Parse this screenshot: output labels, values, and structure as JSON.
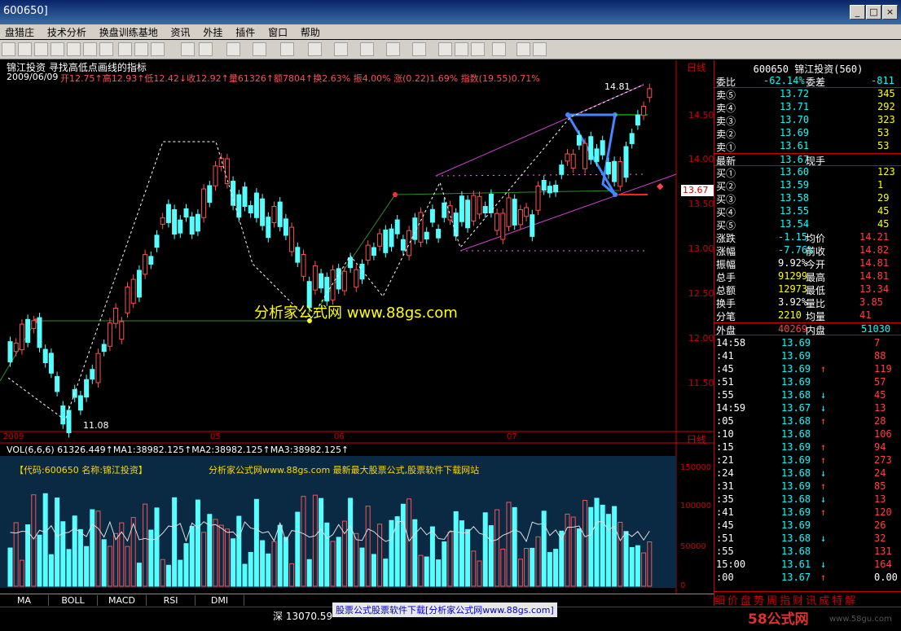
{
  "window": {
    "title": "600650]"
  },
  "menu": [
    "盘猎庄",
    "技术分析",
    "换盘训练基地",
    "资讯",
    "外挂",
    "插件",
    "窗口",
    "帮助"
  ],
  "chart_header": {
    "name_line": "锦江投资 寻找高低点画线的指标",
    "date": "2009/06/09",
    "ohlc": "开12.75↑高12.93↑低12.42↓收12.92↑量61326↑额7804↑换2.63% 振4.00% 涨(0.22)1.69% 指数(19.55)0.71%"
  },
  "price_axis": {
    "labels": [
      "14.50",
      "14.00",
      "13.50",
      "13.00",
      "12.50",
      "12.00",
      "11.50"
    ],
    "current": "13.67",
    "high_label": "14.81",
    "low_label": "11.08"
  },
  "time_axis": [
    "2009",
    "05",
    "06",
    "07"
  ],
  "period_label": "日线",
  "watermark": "分析家公式网 www.88gs.com",
  "volume_header": {
    "text": "VOL(6,6,6) 61326.449↑MA1:38982.125↑MA2:38982.125↑MA3:38982.125↑"
  },
  "volume_panel": {
    "info": "【代码:600650 名称:锦江投资】",
    "promo": "分析家公式网www.88gs.com 最新最大股票公式,股票软件下载网站",
    "axis": [
      "150000",
      "100000",
      "50000",
      "0"
    ]
  },
  "bottom_tabs": [
    "MA",
    "BOLL",
    "MACD",
    "RSI",
    "DMI"
  ],
  "status": {
    "index": "深 13070.59",
    "banner": "股票公式股票软件下载[分析家公式网www.88gs.com]",
    "logo": "58公式网",
    "url": "www.58gu.com"
  },
  "quote": {
    "title": "600650 锦江投资(560)",
    "weibi": {
      "label": "委比",
      "value": "-62.14%",
      "label2": "委差",
      "value2": "-811"
    },
    "sells": [
      {
        "label": "卖⑤",
        "price": "13.72",
        "vol": "345"
      },
      {
        "label": "卖④",
        "price": "13.71",
        "vol": "292"
      },
      {
        "label": "卖③",
        "price": "13.70",
        "vol": "323"
      },
      {
        "label": "卖②",
        "price": "13.69",
        "vol": "53"
      },
      {
        "label": "卖①",
        "price": "13.61",
        "vol": "53"
      }
    ],
    "latest": {
      "label": "最新",
      "value": "13.67",
      "label2": "现手"
    },
    "buys": [
      {
        "label": "买①",
        "price": "13.60",
        "vol": "123"
      },
      {
        "label": "买②",
        "price": "13.59",
        "vol": "1"
      },
      {
        "label": "买③",
        "price": "13.58",
        "vol": "29"
      },
      {
        "label": "买④",
        "price": "13.55",
        "vol": "45"
      },
      {
        "label": "买⑤",
        "price": "13.54",
        "vol": "45"
      }
    ],
    "stats": [
      {
        "l1": "涨跌",
        "v1": "-1.15",
        "l2": "均价",
        "v2": "14.21"
      },
      {
        "l1": "涨幅",
        "v1": "-7.76%",
        "l2": "前收",
        "v2": "14.82"
      },
      {
        "l1": "振幅",
        "v1": "9.92%",
        "l2": "今开",
        "v2": "14.81"
      },
      {
        "l1": "总手",
        "v1": "91299",
        "l2": "最高",
        "v2": "14.81"
      },
      {
        "l1": "总额",
        "v1": "12973",
        "l2": "最低",
        "v2": "13.34"
      },
      {
        "l1": "换手",
        "v1": "3.92%",
        "l2": "量比",
        "v2": "3.85"
      },
      {
        "l1": "分笔",
        "v1": "2210",
        "l2": "均量",
        "v2": "41"
      }
    ],
    "outer": {
      "l1": "外盘",
      "v1": "40269",
      "l2": "内盘",
      "v2": "51030"
    },
    "ticks": [
      {
        "t": "14:58",
        "p": "13.69",
        "a": "",
        "v": "7"
      },
      {
        "t": ":41",
        "p": "13.69",
        "a": "",
        "v": "88"
      },
      {
        "t": ":45",
        "p": "13.69",
        "a": "↑",
        "v": "119"
      },
      {
        "t": ":51",
        "p": "13.69",
        "a": "",
        "v": "57"
      },
      {
        "t": ":55",
        "p": "13.68",
        "a": "↓",
        "v": "45"
      },
      {
        "t": "14:59",
        "p": "13.67",
        "a": "↓",
        "v": "13"
      },
      {
        "t": ":05",
        "p": "13.68",
        "a": "↑",
        "v": "28"
      },
      {
        "t": ":10",
        "p": "13.68",
        "a": "",
        "v": "106"
      },
      {
        "t": ":15",
        "p": "13.69",
        "a": "↑",
        "v": "94"
      },
      {
        "t": ":21",
        "p": "13.69",
        "a": "↑",
        "v": "273"
      },
      {
        "t": ":24",
        "p": "13.68",
        "a": "↓",
        "v": "24"
      },
      {
        "t": ":31",
        "p": "13.69",
        "a": "↑",
        "v": "85"
      },
      {
        "t": ":35",
        "p": "13.68",
        "a": "↓",
        "v": "13"
      },
      {
        "t": ":41",
        "p": "13.69",
        "a": "↑",
        "v": "120"
      },
      {
        "t": ":45",
        "p": "13.69",
        "a": "",
        "v": "26"
      },
      {
        "t": ":51",
        "p": "13.68",
        "a": "↓",
        "v": "32"
      },
      {
        "t": ":55",
        "p": "13.68",
        "a": "",
        "v": "131"
      },
      {
        "t": "15:00",
        "p": "13.61",
        "a": "↓",
        "v": "164"
      },
      {
        "t": ":00",
        "p": "13.67",
        "a": "↑",
        "v": "0.00"
      }
    ],
    "tabs": [
      "细",
      "价",
      "盘",
      "势",
      "周",
      "指",
      "财",
      "讯",
      "成",
      "特",
      "解"
    ]
  }
}
